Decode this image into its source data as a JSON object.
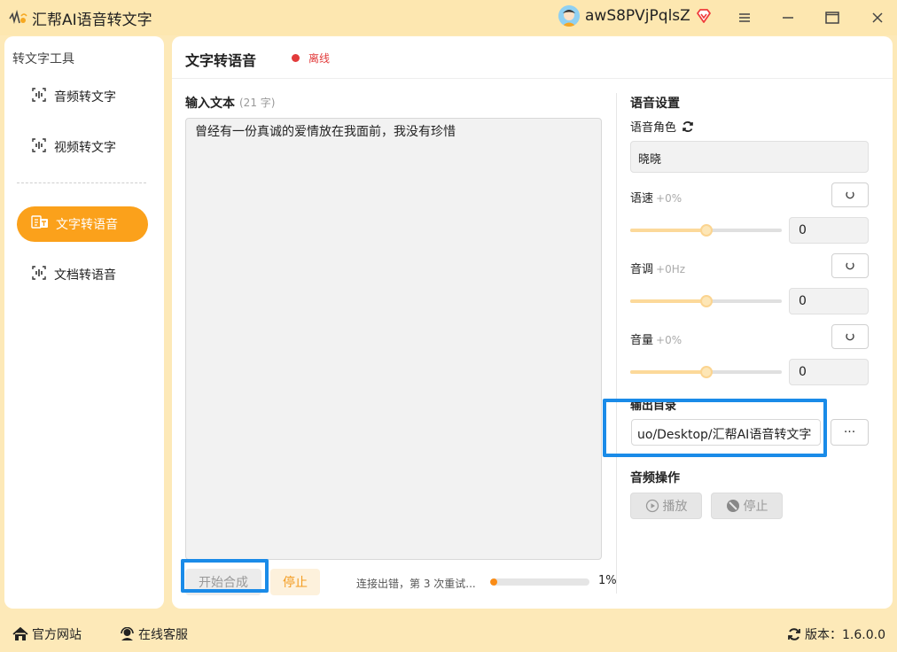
{
  "app": {
    "title": "汇帮AI语音转文字",
    "username": "awS8PVjPqlsZ"
  },
  "sidebar": {
    "title": "转文字工具",
    "items": [
      {
        "label": "音频转文字",
        "icon": "audio-wave-icon"
      },
      {
        "label": "视频转文字",
        "icon": "video-wave-icon"
      },
      {
        "label": "文字转语音",
        "icon": "text-to-speech-icon",
        "active": true
      },
      {
        "label": "文档转语音",
        "icon": "document-wave-icon"
      }
    ]
  },
  "main": {
    "title": "文字转语音",
    "status": "离线",
    "input_label": "输入文本",
    "input_count": "(21 字)",
    "input_text": "曾经有一份真诚的爱情放在我面前，我没有珍惜",
    "start_button": "开始合成",
    "stop_button": "停止",
    "progress_text": "连接出错，第 3 次重试...",
    "progress_value": 0.01,
    "progress_percent": "1%"
  },
  "settings": {
    "title": "语音设置",
    "role_label": "语音角色",
    "role_value": "晓晓",
    "speed": {
      "label": "语速",
      "hint": "+0%",
      "value": "0",
      "level": 0.5
    },
    "pitch": {
      "label": "音调",
      "hint": "+0Hz",
      "value": "0",
      "level": 0.5
    },
    "volume": {
      "label": "音量",
      "hint": "+0%",
      "value": "0",
      "level": 0.5
    },
    "output_label": "输出目录",
    "output_path": "uo/Desktop/汇帮AI语音转文字",
    "browse_label": "···"
  },
  "audio_ops": {
    "title": "音频操作",
    "play": "播放",
    "stop": "停止"
  },
  "footer": {
    "website": "官方网站",
    "support": "在线客服",
    "version": "版本：1.6.0.0"
  },
  "colors": {
    "accent": "#fba11b",
    "title_bar": "#fde7b0",
    "status_offline": "#e23b3b",
    "highlight": "#1a8be8"
  }
}
